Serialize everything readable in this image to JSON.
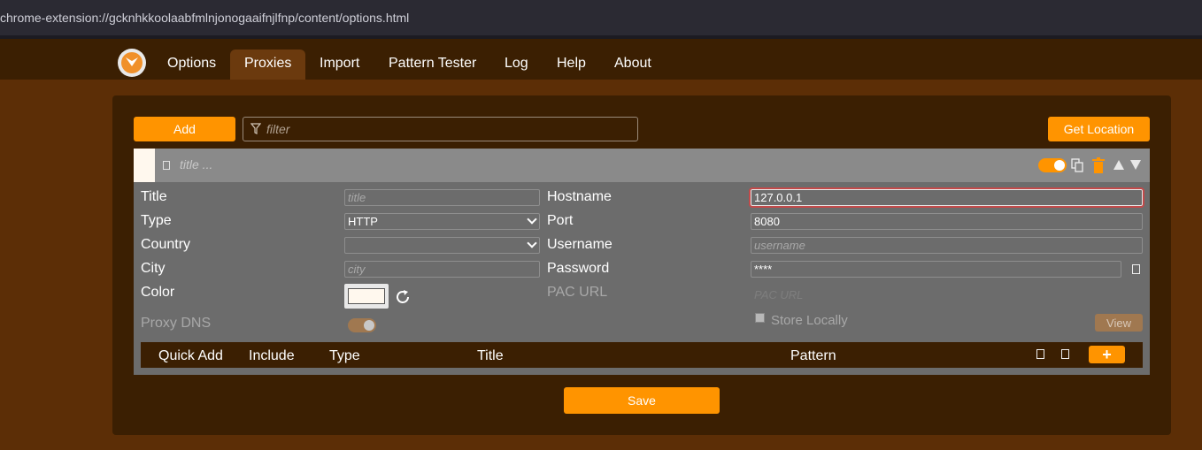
{
  "browser": {
    "url": "chrome-extension://gcknhkkoolaabfmlnjonogaaifnjlfnp/content/options.html"
  },
  "nav": {
    "items": [
      {
        "label": "Options"
      },
      {
        "label": "Proxies"
      },
      {
        "label": "Import"
      },
      {
        "label": "Pattern Tester"
      },
      {
        "label": "Log"
      },
      {
        "label": "Help"
      },
      {
        "label": "About"
      }
    ],
    "active": "Proxies"
  },
  "toolbar": {
    "add_label": "Add",
    "filter_placeholder": "filter",
    "get_location_label": "Get Location"
  },
  "proxy": {
    "header_title_placeholder": "title ...",
    "enabled": true,
    "fields": {
      "title": {
        "label": "Title",
        "placeholder": "title"
      },
      "type": {
        "label": "Type",
        "value": "HTTP"
      },
      "country": {
        "label": "Country",
        "value": ""
      },
      "city": {
        "label": "City",
        "placeholder": "city"
      },
      "color": {
        "label": "Color",
        "value": "#fff8ee"
      },
      "proxy_dns": {
        "label": "Proxy DNS"
      },
      "hostname": {
        "label": "Hostname",
        "value": "127.0.0.1"
      },
      "port": {
        "label": "Port",
        "value": "8080"
      },
      "username": {
        "label": "Username",
        "placeholder": "username"
      },
      "password": {
        "label": "Password",
        "value": "****"
      },
      "pac_url": {
        "label": "PAC URL",
        "placeholder": "PAC URL"
      },
      "store_locally": {
        "label": "Store Locally"
      },
      "view_label": "View"
    }
  },
  "patterns": {
    "columns": [
      "Quick Add",
      "Include",
      "Type",
      "Title",
      "Pattern"
    ],
    "add_label": "+"
  },
  "save_label": "Save",
  "colors": {
    "accent": "#ff9400",
    "background": "#5c2e06",
    "panel": "#3b1f02"
  }
}
